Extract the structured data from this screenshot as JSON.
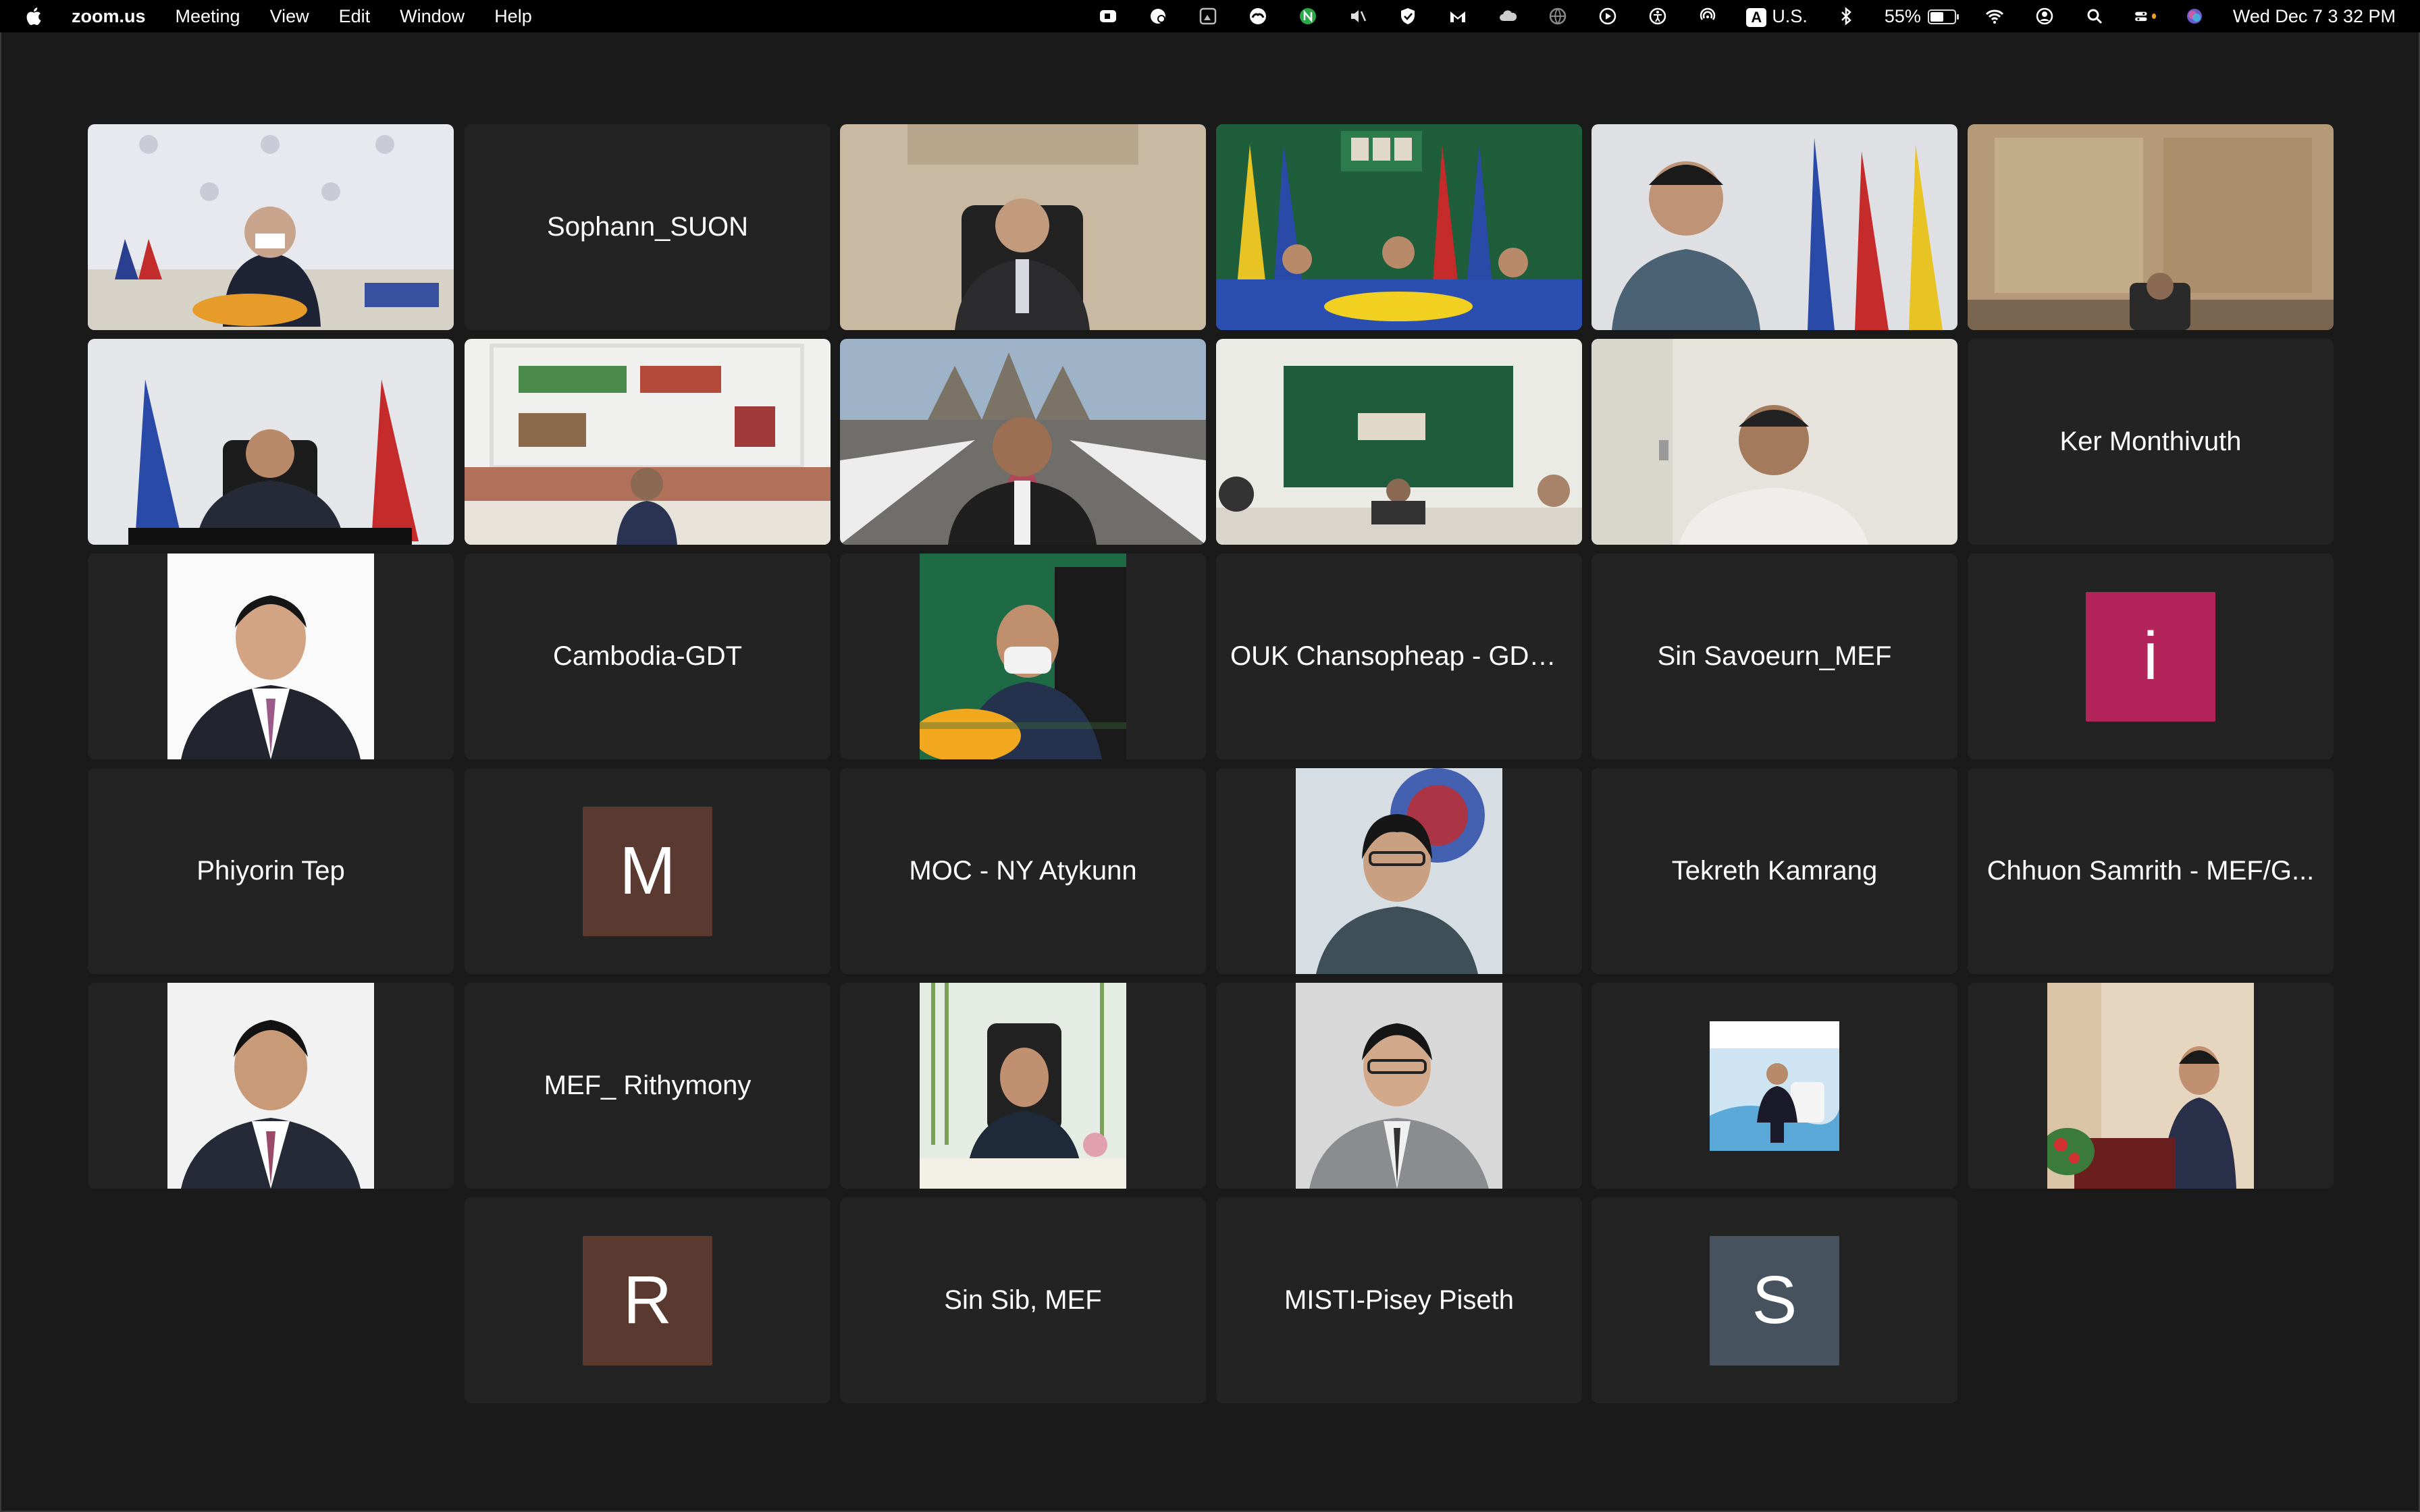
{
  "menubar": {
    "app_name": "zoom.us",
    "menus": [
      "Meeting",
      "View",
      "Edit",
      "Window",
      "Help"
    ],
    "input_source": "U.S.",
    "battery_percent": "55%",
    "battery_level": 0.55,
    "datetime": "Wed Dec 7  3 32 PM"
  },
  "tiles": {
    "t02_name": "Sophann_SUON",
    "t12_name": "Ker Monthivuth",
    "t14_name": "Cambodia-GDT",
    "t16_name": "OUK Chansopheap - GDC...",
    "t17_name": "Sin Savoeurn_MEF",
    "t18_letter": "i",
    "t19_name": "Phiyorin Tep",
    "t20_letter": "M",
    "t21_name": "MOC - NY Atykunn",
    "t23_name": "Tekreth Kamrang",
    "t24_name": "Chhuon Samrith - MEF/G...",
    "t26_name": "MEF_ Rithymony",
    "t31_letter": "R",
    "t32_name": "Sin Sib, MEF",
    "t33_name": "MISTI-Pisey Piseth",
    "t34_letter": "S"
  },
  "colors": {
    "avatar_i": "#b3245b",
    "avatar_m": "#5a3a30",
    "avatar_r": "#5a3a30",
    "avatar_s": "#46525e",
    "active_speaker": "#3ccd3c"
  }
}
